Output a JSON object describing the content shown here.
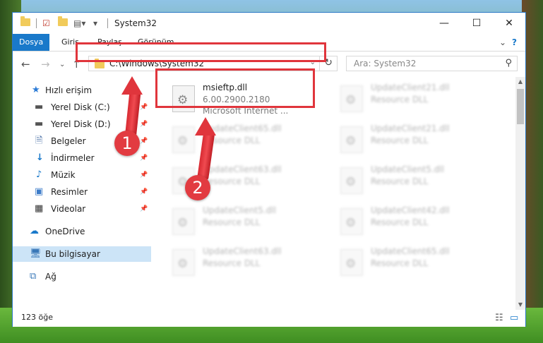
{
  "window": {
    "title": "System32",
    "controls": {
      "minimize": "—",
      "maximize": "☐",
      "close": "✕"
    }
  },
  "ribbon": {
    "tabs": [
      {
        "label": "Dosya",
        "active": true
      },
      {
        "label": "Giriş"
      },
      {
        "label": "Paylaş"
      },
      {
        "label": "Görünüm"
      }
    ],
    "expand_icon": "chevron-down-icon",
    "help_icon": "help-icon"
  },
  "address": {
    "path": "C:\\Windows\\System32",
    "search_placeholder": "Ara: System32"
  },
  "sidebar": {
    "items": [
      {
        "label": "Hızlı erişim",
        "icon": "star-icon",
        "pinned": false
      },
      {
        "label": "Yerel Disk (C:)",
        "icon": "drive-icon",
        "pinned": true
      },
      {
        "label": "Yerel Disk (D:)",
        "icon": "drive-icon",
        "pinned": true
      },
      {
        "label": "Belgeler",
        "icon": "documents-icon",
        "pinned": true
      },
      {
        "label": "İndirmeler",
        "icon": "download-icon",
        "pinned": true
      },
      {
        "label": "Müzik",
        "icon": "music-icon",
        "pinned": true
      },
      {
        "label": "Resimler",
        "icon": "pictures-icon",
        "pinned": true
      },
      {
        "label": "Videolar",
        "icon": "videos-icon",
        "pinned": true
      },
      {
        "label": "OneDrive",
        "icon": "cloud-icon",
        "pinned": false
      },
      {
        "label": "Bu bilgisayar",
        "icon": "computer-icon",
        "pinned": false,
        "selected": true
      },
      {
        "label": "Ağ",
        "icon": "network-icon",
        "pinned": false
      }
    ]
  },
  "files": {
    "left_column": [
      {
        "name": "msieftp.dll",
        "line1": "6.00.2900.2180",
        "line2": "Microsoft Internet ..."
      },
      {
        "name": "UpdateClient65.dll",
        "line1": "Resource DLL"
      },
      {
        "name": "UpdateClient63.dll",
        "line1": "Resource DLL"
      },
      {
        "name": "UpdateClient5.dll",
        "line1": "Resource DLL"
      },
      {
        "name": "UpdateClient63.dll",
        "line1": "Resource DLL"
      }
    ],
    "right_column": [
      {
        "name": "UpdateClient21.dll",
        "line1": "Resource DLL"
      },
      {
        "name": "UpdateClient21.dll",
        "line1": "Resource DLL"
      },
      {
        "name": "UpdateClient5.dll",
        "line1": "Resource DLL"
      },
      {
        "name": "UpdateClient42.dll",
        "line1": "Resource DLL"
      },
      {
        "name": "UpdateClient65.dll",
        "line1": "Resource DLL"
      }
    ]
  },
  "status": {
    "item_count": "123 öğe"
  },
  "annotations": {
    "step1": "1",
    "step2": "2"
  },
  "colors": {
    "accent": "#1979ca",
    "highlight": "#e0353c"
  }
}
